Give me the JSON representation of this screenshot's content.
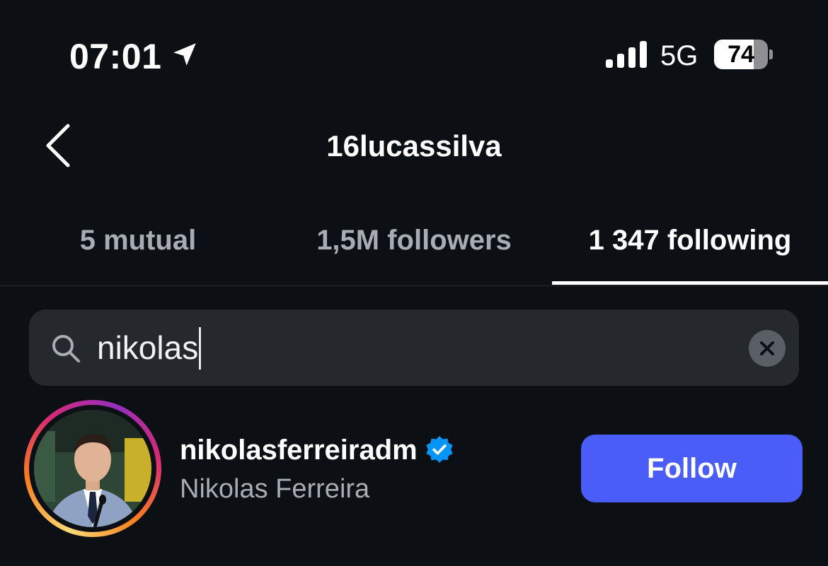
{
  "status_bar": {
    "time": "07:01",
    "network": "5G",
    "battery_percent": 74,
    "battery_label": "74"
  },
  "header": {
    "title": "16lucassilva",
    "back_icon": "chevron-left-icon"
  },
  "tabs": [
    {
      "label": "5 mutual",
      "active": false
    },
    {
      "label": "1,5M followers",
      "active": false
    },
    {
      "label": "1 347 following",
      "active": true
    }
  ],
  "search": {
    "value": "nikolas",
    "icon": "search-icon",
    "clear_icon": "clear-icon"
  },
  "results": [
    {
      "username": "nikolasferreiradm",
      "full_name": "Nikolas Ferreira",
      "verified": true,
      "has_story": true,
      "action_label": "Follow"
    }
  ],
  "colors": {
    "background": "#0c1014",
    "accent": "#4a5df9",
    "verified": "#0095f6",
    "search_bg": "#25292e"
  }
}
